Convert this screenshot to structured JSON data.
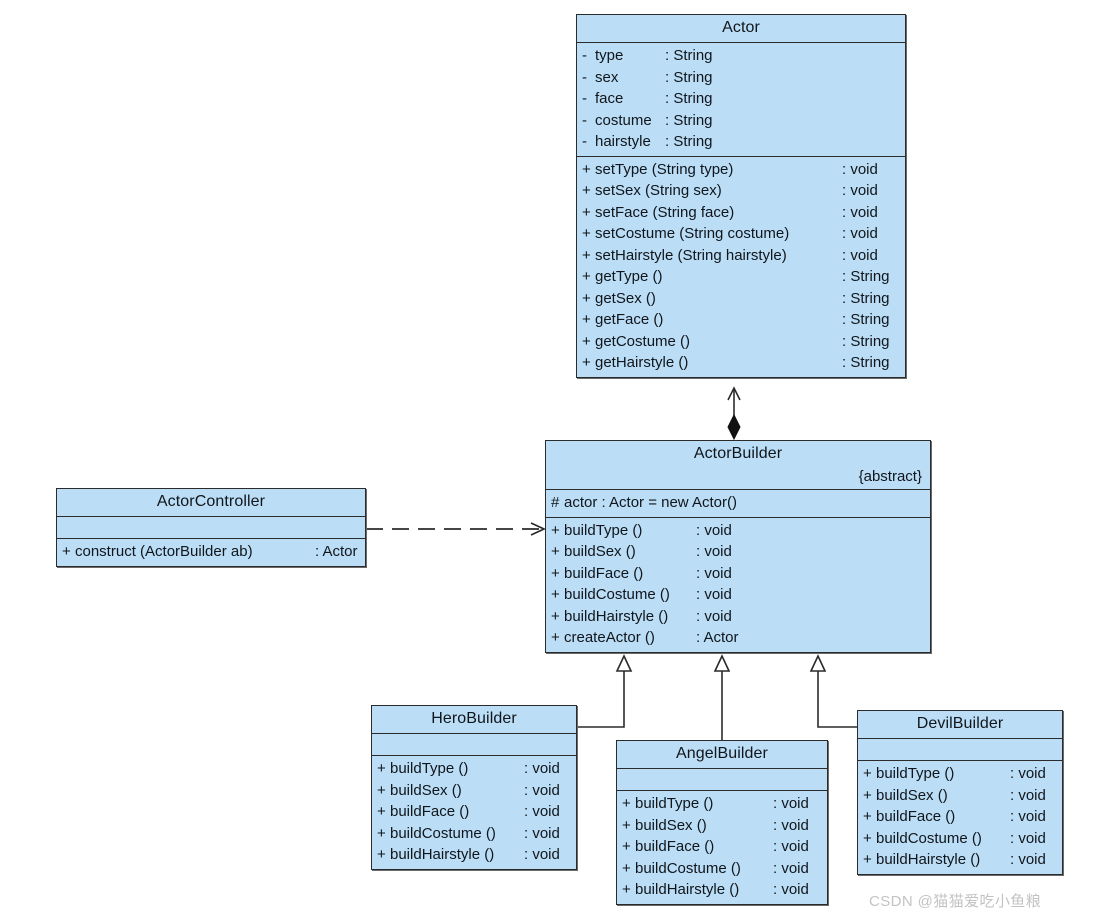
{
  "diagram": {
    "kind": "uml-class-diagram",
    "background": "#ffffff",
    "class_fill": "#bbddf5",
    "class_border": "#2b2b2b",
    "watermark": "CSDN @猫猫爱吃小鱼粮"
  },
  "classes": {
    "actor": {
      "name": "Actor",
      "attributes": [
        {
          "vis": "-",
          "name": "type",
          "type": ": String"
        },
        {
          "vis": "-",
          "name": "sex",
          "type": ": String"
        },
        {
          "vis": "-",
          "name": "face",
          "type": ": String"
        },
        {
          "vis": "-",
          "name": "costume",
          "type": ": String"
        },
        {
          "vis": "-",
          "name": "hairstyle",
          "type": ": String"
        }
      ],
      "operations": [
        {
          "vis": "+",
          "name": "setType (String type)",
          "type": ": void"
        },
        {
          "vis": "+",
          "name": "setSex (String sex)",
          "type": ": void"
        },
        {
          "vis": "+",
          "name": "setFace (String face)",
          "type": ": void"
        },
        {
          "vis": "+",
          "name": "setCostume (String costume)",
          "type": ": void"
        },
        {
          "vis": "+",
          "name": "setHairstyle (String hairstyle)",
          "type": ": void"
        },
        {
          "vis": "+",
          "name": "getType ()",
          "type": ": String"
        },
        {
          "vis": "+",
          "name": "getSex ()",
          "type": ": String"
        },
        {
          "vis": "+",
          "name": "getFace ()",
          "type": ": String"
        },
        {
          "vis": "+",
          "name": "getCostume ()",
          "type": ": String"
        },
        {
          "vis": "+",
          "name": "getHairstyle ()",
          "type": ": String"
        }
      ]
    },
    "actor_builder": {
      "name": "ActorBuilder",
      "stereotype": "{abstract}",
      "attributes": [
        {
          "vis": "#",
          "name": "actor : Actor  = new Actor()",
          "type": ""
        }
      ],
      "operations": [
        {
          "vis": "+",
          "name": "buildType ()",
          "type": ": void"
        },
        {
          "vis": "+",
          "name": "buildSex ()",
          "type": ": void"
        },
        {
          "vis": "+",
          "name": "buildFace ()",
          "type": ": void"
        },
        {
          "vis": "+",
          "name": "buildCostume ()",
          "type": ": void"
        },
        {
          "vis": "+",
          "name": "buildHairstyle ()",
          "type": ": void"
        },
        {
          "vis": "+",
          "name": "createActor ()",
          "type": ": Actor"
        }
      ]
    },
    "actor_controller": {
      "name": "ActorController",
      "attributes": [],
      "operations": [
        {
          "vis": "+",
          "name": "construct (ActorBuilder ab)",
          "type": ": Actor"
        }
      ]
    },
    "hero_builder": {
      "name": "HeroBuilder",
      "attributes": [],
      "operations": [
        {
          "vis": "+",
          "name": "buildType ()",
          "type": ": void"
        },
        {
          "vis": "+",
          "name": "buildSex ()",
          "type": ": void"
        },
        {
          "vis": "+",
          "name": "buildFace ()",
          "type": ": void"
        },
        {
          "vis": "+",
          "name": "buildCostume ()",
          "type": ": void"
        },
        {
          "vis": "+",
          "name": "buildHairstyle ()",
          "type": ": void"
        }
      ]
    },
    "angel_builder": {
      "name": "AngelBuilder",
      "attributes": [],
      "operations": [
        {
          "vis": "+",
          "name": "buildType ()",
          "type": ": void"
        },
        {
          "vis": "+",
          "name": "buildSex ()",
          "type": ": void"
        },
        {
          "vis": "+",
          "name": "buildFace ()",
          "type": ": void"
        },
        {
          "vis": "+",
          "name": "buildCostume ()",
          "type": ": void"
        },
        {
          "vis": "+",
          "name": "buildHairstyle ()",
          "type": ": void"
        }
      ]
    },
    "devil_builder": {
      "name": "DevilBuilder",
      "attributes": [],
      "operations": [
        {
          "vis": "+",
          "name": "buildType ()",
          "type": ": void"
        },
        {
          "vis": "+",
          "name": "buildSex ()",
          "type": ": void"
        },
        {
          "vis": "+",
          "name": "buildFace ()",
          "type": ": void"
        },
        {
          "vis": "+",
          "name": "buildCostume ()",
          "type": ": void"
        },
        {
          "vis": "+",
          "name": "buildHairstyle ()",
          "type": ": void"
        }
      ]
    }
  },
  "relationships": [
    {
      "id": "composition-actorbuilder-actor",
      "type": "composition",
      "from": "ActorBuilder",
      "to": "Actor"
    },
    {
      "id": "dependency-actorcontroller-actorbuilder",
      "type": "dependency",
      "from": "ActorController",
      "to": "ActorBuilder"
    },
    {
      "id": "generalization-herobuilder-actorbuilder",
      "type": "generalization",
      "from": "HeroBuilder",
      "to": "ActorBuilder"
    },
    {
      "id": "generalization-angelbuilder-actorbuilder",
      "type": "generalization",
      "from": "AngelBuilder",
      "to": "ActorBuilder"
    },
    {
      "id": "generalization-devilbuilder-actorbuilder",
      "type": "generalization",
      "from": "DevilBuilder",
      "to": "ActorBuilder"
    }
  ]
}
